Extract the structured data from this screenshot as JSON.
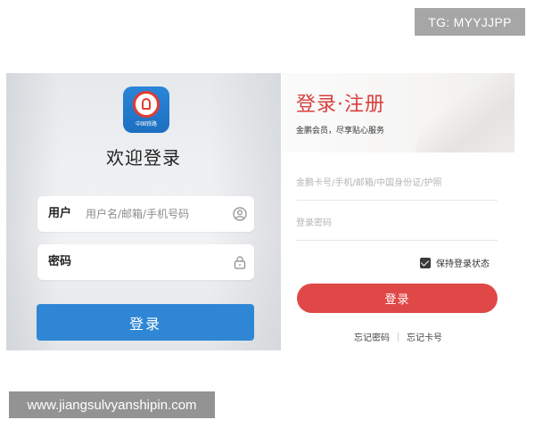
{
  "watermark_tag": "TG: MYYJJPP",
  "watermark_url": "www.jiangsulvyanshipin.com",
  "left_panel": {
    "logo_text": "中国铁路",
    "welcome": "欢迎登录",
    "user_label": "用户",
    "user_placeholder": "用户名/邮箱/手机号码",
    "user_icon": "user-circle-icon",
    "password_label": "密码",
    "password_icon": "lock-icon",
    "login_button": "登录",
    "button_color": "#2f86d4"
  },
  "right_panel": {
    "title": "登录·注册",
    "subtitle": "金鹏会员，尽享贴心服务",
    "card_placeholder": "金鹏卡号/手机/邮箱/中国身份证/护照",
    "password_placeholder": "登录密码",
    "keep_login_label": "保持登录状态",
    "keep_login_checked": true,
    "login_button": "登录",
    "forgot_password": "忘记密码",
    "forgot_card": "忘记卡号",
    "accent_color": "#d8403e"
  }
}
